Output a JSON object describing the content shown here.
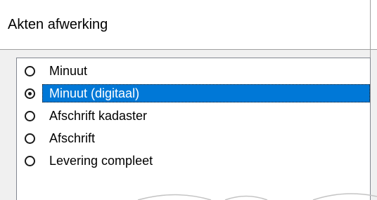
{
  "dialog": {
    "title": "Akten afwerking"
  },
  "options": {
    "items": [
      {
        "label": "Minuut",
        "checked": false,
        "selected": false
      },
      {
        "label": "Minuut (digitaal)",
        "checked": true,
        "selected": true
      },
      {
        "label": "Afschrift kadaster",
        "checked": false,
        "selected": false
      },
      {
        "label": "Afschrift",
        "checked": false,
        "selected": false
      },
      {
        "label": "Levering compleet",
        "checked": false,
        "selected": false
      }
    ]
  },
  "colors": {
    "selection": "#0078d7",
    "border": "#828790",
    "window_bg": "#f0f0f0"
  }
}
